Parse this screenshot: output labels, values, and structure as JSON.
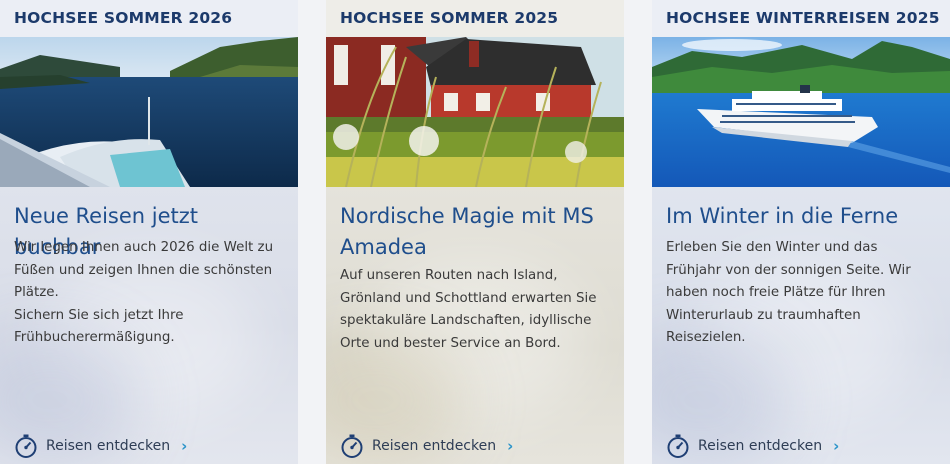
{
  "cards": [
    {
      "eyebrow": "HOCHSEE SOMMER 2026",
      "image": "cruise-ship-bow-fjord",
      "title": "Neue Reisen jetzt buchbar",
      "lines": [
        "Wir legen Ihnen auch 2026 die Welt zu",
        "Füßen und zeigen Ihnen die schönsten",
        "Plätze.",
        "Sichern Sie sich jetzt Ihre",
        "Frühbucherermäßigung."
      ],
      "cta": "Reisen entdecken"
    },
    {
      "eyebrow": "HOCHSEE SOMMER 2025",
      "image": "nordic-red-houses-meadow",
      "title_lines": [
        "Nordische Magie mit MS",
        "Amadea"
      ],
      "lines": [
        "Auf unseren Routen nach Island,",
        "Grönland und Schottland erwarten Sie",
        "spektakuläre Landschaften, idyllische",
        "Orte und bester Service an Bord."
      ],
      "cta": "Reisen entdecken"
    },
    {
      "eyebrow": "HOCHSEE WINTERREISEN 2025",
      "image": "cruise-ship-blue-sea",
      "title": "Im Winter in die Ferne",
      "lines": [
        "Erleben Sie den Winter und das",
        "Frühjahr von der sonnigen Seite. Wir",
        "haben noch freie Plätze für Ihren",
        "Winterurlaub zu traumhaften",
        "Reisezielen."
      ],
      "cta": "Reisen entdecken"
    }
  ],
  "icons": {
    "cta": "stopwatch-icon",
    "chevron": "chevron-right-icon"
  },
  "colors": {
    "title": "#1f4e8c",
    "eyebrow": "#1c3a6b",
    "chevron": "#2a93c9",
    "background": "#f2f3f6"
  }
}
